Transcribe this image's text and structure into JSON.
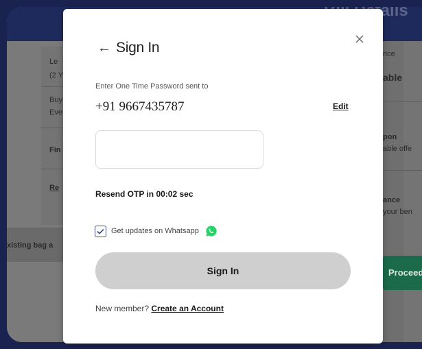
{
  "background_page": {
    "header_title": "Bill Details",
    "left_lines": [
      "Le",
      "(2 Y",
      "Buy",
      "Eve",
      "Fin",
      "Re"
    ],
    "left_strip_text": "xisting bag a",
    "right_lines": [
      "rice",
      "able",
      "pon",
      "able offe",
      "ance",
      "your ben"
    ],
    "proceed_label": "Proceed"
  },
  "modal": {
    "back_icon": "arrow-left-icon",
    "title": "Sign In",
    "close_icon": "close-icon",
    "otp_label": "Enter One Time Password sent to",
    "phone_number": "+91 9667435787",
    "edit_label": "Edit",
    "otp_value": "",
    "resend_text": "Resend OTP in 00:02 sec",
    "whatsapp": {
      "checked": true,
      "label": "Get updates on Whatsapp",
      "icon": "whatsapp-icon",
      "icon_color": "#25d366"
    },
    "signin_label": "Sign In",
    "signin_color": "#cfcfcf",
    "new_member_text": "New member?",
    "create_account_label": "Create an Account"
  }
}
